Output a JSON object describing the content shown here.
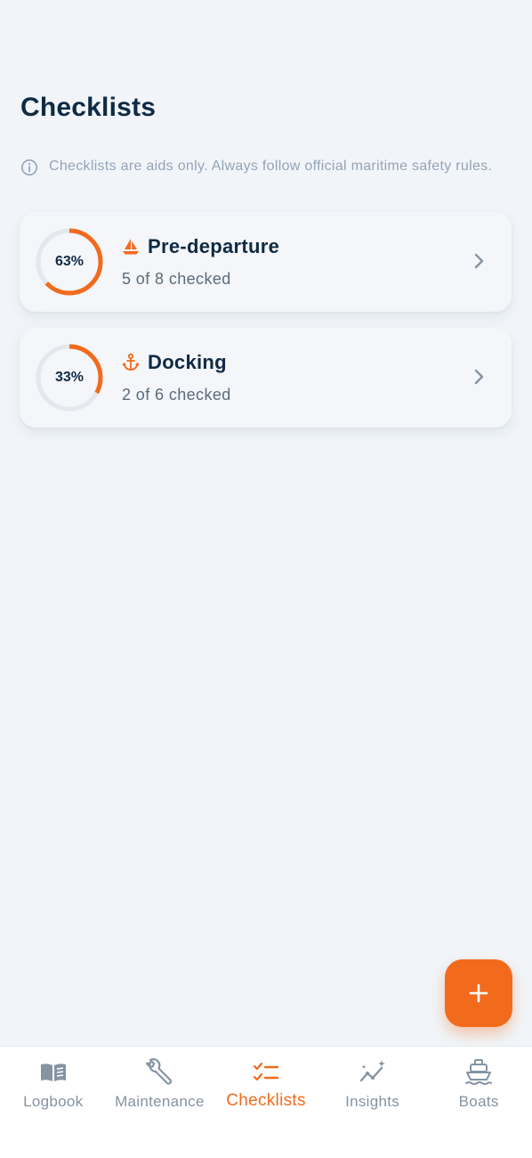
{
  "header": {
    "title": "Checklists"
  },
  "notice": {
    "text": "Checklists are aids only. Always follow official maritime safety rules."
  },
  "checklists": [
    {
      "title": "Pre-departure",
      "icon": "sailboat-icon",
      "percent_label": "63%",
      "progress": 0.63,
      "subtitle": "5 of 8 checked"
    },
    {
      "title": "Docking",
      "icon": "anchor-icon",
      "percent_label": "33%",
      "progress": 0.33,
      "subtitle": "2 of 6 checked"
    }
  ],
  "tabs": [
    {
      "label": "Logbook",
      "icon": "book-icon",
      "active": false
    },
    {
      "label": "Maintenance",
      "icon": "wrench-icon",
      "active": false
    },
    {
      "label": "Checklists",
      "icon": "checklist-icon",
      "active": true
    },
    {
      "label": "Insights",
      "icon": "sparkle-chart-icon",
      "active": false
    },
    {
      "label": "Boats",
      "icon": "ship-icon",
      "active": false
    }
  ],
  "colors": {
    "accent": "#f26b1d",
    "text": "#0f2a44",
    "muted": "#94a3b8",
    "background": "#f1f5f9",
    "track": "#e3e8ee"
  }
}
